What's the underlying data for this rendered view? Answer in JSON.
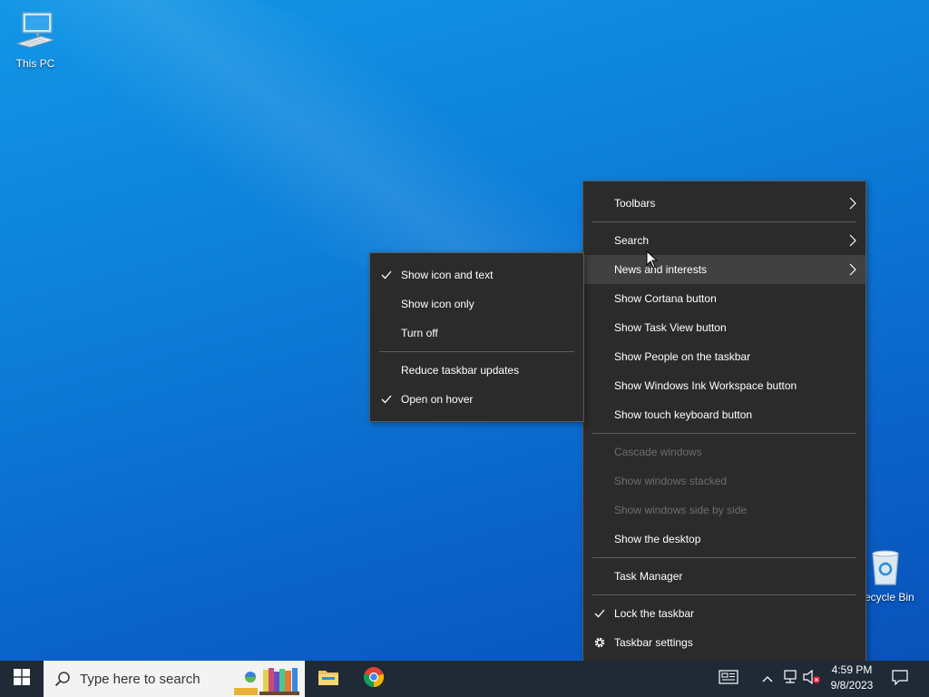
{
  "desktop": {
    "icons": {
      "this_pc": "This PC",
      "recycle_bin": "Recycle Bin"
    }
  },
  "context_menu": {
    "items": {
      "toolbars": "Toolbars",
      "search": "Search",
      "news_and_interests": "News and interests",
      "show_cortana": "Show Cortana button",
      "show_task_view": "Show Task View button",
      "show_people": "Show People on the taskbar",
      "show_ink_workspace": "Show Windows Ink Workspace button",
      "show_touch_keyboard": "Show touch keyboard button",
      "cascade_windows": "Cascade windows",
      "show_stacked": "Show windows stacked",
      "show_side_by_side": "Show windows side by side",
      "show_desktop": "Show the desktop",
      "task_manager": "Task Manager",
      "lock_taskbar": "Lock the taskbar",
      "taskbar_settings": "Taskbar settings"
    },
    "checked": {
      "lock_taskbar": true
    }
  },
  "submenu": {
    "items": {
      "show_icon_and_text": "Show icon and text",
      "show_icon_only": "Show icon only",
      "turn_off": "Turn off",
      "reduce_updates": "Reduce taskbar updates",
      "open_on_hover": "Open on hover"
    },
    "checked": {
      "show_icon_and_text": true,
      "open_on_hover": true
    }
  },
  "taskbar": {
    "search_placeholder": "Type here to search",
    "clock": {
      "time": "4:59 PM",
      "date": "9/8/2023"
    },
    "icons": [
      "windows-start-icon",
      "search-icon",
      "news-widget-icon",
      "file-explorer-icon",
      "chrome-icon",
      "news-and-interests-icon",
      "show-hidden-icons-chevron",
      "network-icon",
      "volume-muted-icon",
      "notification-icon"
    ]
  },
  "colors": {
    "menu_bg": "#2b2b2b",
    "menu_hover": "#414141",
    "taskbar_bg": "#1f2a36",
    "desktop_blue": "#0d7fd9"
  }
}
